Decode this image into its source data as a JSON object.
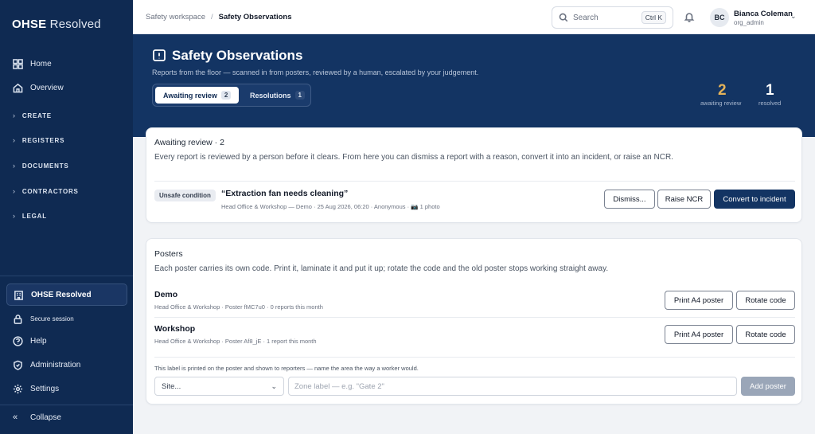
{
  "brand": {
    "bold": "OHSE",
    "light": " Resolved"
  },
  "sidebar": {
    "items": [
      {
        "label": "Home"
      },
      {
        "label": "Overview"
      }
    ],
    "sections": [
      {
        "label": "CREATE"
      },
      {
        "label": "REGISTERS"
      },
      {
        "label": "DOCUMENTS"
      },
      {
        "label": "CONTRACTORS"
      },
      {
        "label": "LEGAL"
      }
    ],
    "org": "OHSE Resolved",
    "secure": "Secure session",
    "bottom": [
      {
        "label": "Help"
      },
      {
        "label": "Administration"
      },
      {
        "label": "Settings"
      }
    ],
    "collapse": "Collapse"
  },
  "topbar": {
    "crumb_parent": "Safety workspace",
    "crumb_sep": "/",
    "crumb_current": "Safety Observations",
    "search_label": "Search",
    "search_kbd": "Ctrl K",
    "avatar": "BC",
    "user_name": "Bianca Coleman",
    "user_role": "org_admin"
  },
  "hero": {
    "title": "Safety Observations",
    "subtitle": "Reports from the floor — scanned in from posters, reviewed by a human, escalated by your judgement.",
    "tabs": [
      {
        "label": "Awaiting review",
        "count": "2"
      },
      {
        "label": "Resolutions",
        "count": "1"
      }
    ],
    "stats": [
      {
        "value": "2",
        "label": "awaiting review"
      },
      {
        "value": "1",
        "label": "resolved"
      }
    ]
  },
  "review": {
    "title": "Awaiting review · 2",
    "description": "Every report is reviewed by a person before it clears. From here you can dismiss a report with a reason, convert it into an incident, or raise an NCR.",
    "item": {
      "badge": "Unsafe condition",
      "title": "“Extraction fan needs cleaning”",
      "meta": "Head Office & Workshop — Demo · 25 Aug 2026, 06:20 · Anonymous · 📷 1 photo",
      "dismiss": "Dismiss...",
      "raise_ncr": "Raise NCR",
      "convert": "Convert to incident"
    }
  },
  "posters": {
    "title": "Posters",
    "description": "Each poster carries its own code. Print it, laminate it and put it up; rotate the code and the old poster stops working straight away.",
    "items": [
      {
        "name": "Demo",
        "meta": "Head Office & Workshop · Poster fMC7u0 · 0 reports this month"
      },
      {
        "name": "Workshop",
        "meta": "Head Office & Workshop · Poster Af8_jE · 1 report this month"
      }
    ],
    "print_label": "Print A4 poster",
    "rotate_label": "Rotate code",
    "hint": "This label is printed on the poster and shown to reporters — name the area the way a worker would.",
    "site_select": "Site...",
    "zone_placeholder": "Zone label — e.g. \"Gate 2\"",
    "add_label": "Add poster"
  },
  "colors": {
    "sidebar": "#0f2a52",
    "hero": "#133463",
    "accent_amber": "#e3b25a",
    "primary": "#133463"
  }
}
